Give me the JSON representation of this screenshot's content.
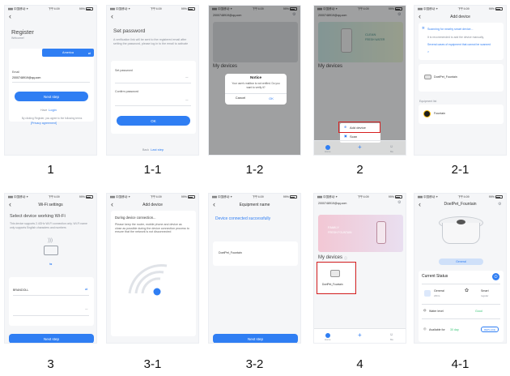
{
  "captions": [
    "1",
    "1-1",
    "1-2",
    "2",
    "2-1",
    "3",
    "3-1",
    "3-2",
    "4",
    "4-1"
  ],
  "status_bar": {
    "carrier": "▮▮▮ 中国移动 ✦",
    "time": "下午4:09",
    "battery": "99%"
  },
  "s1": {
    "title": "Register",
    "welcome": "Welcome!",
    "region": "America",
    "email_label": "Email",
    "email_value": "2000748919@qq.com",
    "next_btn": "Next step",
    "have_account": "Have",
    "login_link": "Login",
    "agree_text": "By clicking Register, you agree to the following terms",
    "privacy_link": "[Privacy agreement]"
  },
  "s11": {
    "title": "Set password",
    "desc": "A verification link will be sent to the registered email after setting the password, please log in to the email to activate",
    "password_label": "Set password",
    "confirm_label": "Confirm password",
    "ok_btn": "OK",
    "back_text": "Back",
    "last_step": "Last step"
  },
  "s12": {
    "account": "2000748919@qq.com",
    "devices": "My devices",
    "notice_title": "Notice",
    "notice_msg": "Your user's mailbox is not verified. Do you want to verify it?",
    "cancel": "Cancel",
    "ok": "OK"
  },
  "s2": {
    "account": "2000748919@qq.com",
    "banner_line1": "CLEAN",
    "banner_line2": "FRESH WATER",
    "devices": "My devices",
    "add_device": "Add device",
    "scan": "Scan",
    "tab_home": "Home",
    "tab_me": "Me"
  },
  "s21": {
    "title": "Add device",
    "scanning": "Scanning for nearby smart device...",
    "scan_hint_a": "It is recommended to add the device manually,",
    "scan_hint_b": "Several cases of equipment that cannot be scanned",
    "scan_hint_c": ">",
    "found_device": "DoelPet_Fountain",
    "list_label": "Equipment list",
    "list_item": "Fountain"
  },
  "s3": {
    "title": "Wi-Fi settings",
    "heading": "Select device working Wi-Fi",
    "desc": "This device supports 2.4GHz Wi-Fi connection only. Wi-Fi name only supports English characters and numbers",
    "ssid": "BRANDOLL",
    "next_btn": "Next step"
  },
  "s31": {
    "title": "Add device",
    "heading": "During device connection...",
    "desc": "Please keep the router, mobile phone and device as close as possible during the device connection process to ensure that the network is not disconnected"
  },
  "s32": {
    "title": "Equipment name",
    "success": "Device connected successfully",
    "name_value": "DoelPet_Fountain",
    "next_btn": "Next step"
  },
  "s4": {
    "account": "2000748919@qq.com",
    "banner_line1": "FAMILY",
    "banner_line2": "FRESH FOUNTAIN",
    "devices": "My devices",
    "device_name": "DoelPet_Fountain",
    "tab_home": "Home",
    "tab_me": "Me"
  },
  "s41": {
    "title": "DoelPet_Fountain",
    "mode_btn": "General",
    "current_status": "Current Status",
    "mode1_name": "General",
    "mode1_sub": "24hrs",
    "mode2_name": "Smart",
    "mode2_sub": "regular",
    "water_label": "Water level",
    "water_value": "Good",
    "filter_label": "Available for",
    "filter_days": "30 day",
    "replace_btn": "REPLACE"
  },
  "colors": {
    "accent": "#2f7ef3",
    "highlight": "#d62020",
    "success": "#3ec77a"
  }
}
